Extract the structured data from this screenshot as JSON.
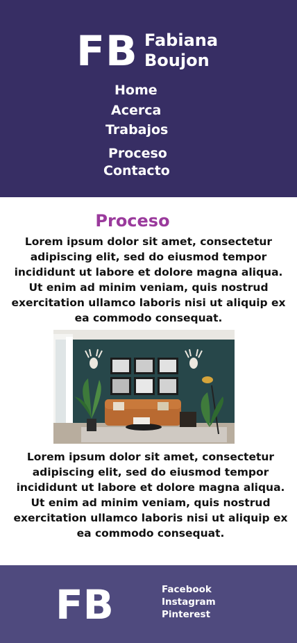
{
  "header": {
    "logo_initials": "FB",
    "name_line1": "Fabiana",
    "name_line2": "Boujon",
    "nav": [
      "Home",
      "Acerca",
      "Trabajos",
      "Proceso",
      "Contacto"
    ]
  },
  "main": {
    "title": "Proceso",
    "paragraph1": "Lorem ipsum dolor sit amet, consectetur adipiscing elit, sed do eiusmod tempor incididunt ut labore et dolore magna aliqua. Ut enim ad minim veniam, quis nostrud exercitation ullamco laboris nisi ut aliquip ex ea commodo consequat.",
    "paragraph2": "Lorem ipsum dolor sit amet, consectetur adipiscing elit, sed do eiusmod tempor incididunt ut labore et dolore magna aliqua. Ut enim ad minim veniam, quis nostrud exercitation ullamco laboris nisi ut aliquip ex ea commodo consequat."
  },
  "footer": {
    "logo_initials": "FB",
    "social": [
      "Facebook",
      "Instagram",
      "Pinterest"
    ]
  },
  "colors": {
    "header_bg": "#372e64",
    "footer_bg": "#4f4a7e",
    "title_accent": "#9a3a9c"
  }
}
